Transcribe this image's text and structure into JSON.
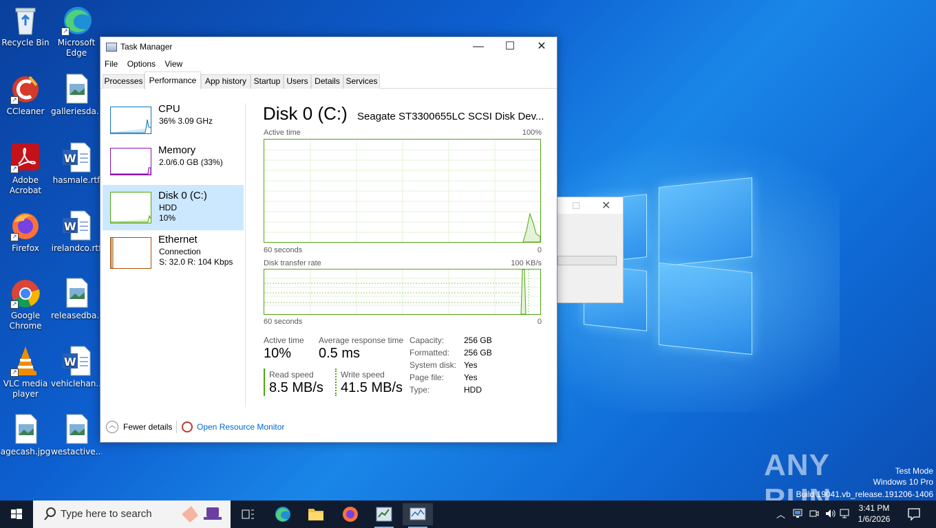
{
  "desktop": {
    "icons": [
      {
        "label": "Recycle Bin",
        "name": "recycle-bin"
      },
      {
        "label": "Microsoft\nEdge",
        "name": "microsoft-edge"
      },
      {
        "label": "CCleaner",
        "name": "ccleaner"
      },
      {
        "label": "galleriesda...",
        "name": "galleriesda"
      },
      {
        "label": "Adobe\nAcrobat",
        "name": "adobe-acrobat"
      },
      {
        "label": "hasmale.rtf",
        "name": "hasmale-rtf"
      },
      {
        "label": "Firefox",
        "name": "firefox"
      },
      {
        "label": "irelandco.rtf",
        "name": "irelandco-rtf"
      },
      {
        "label": "Google\nChrome",
        "name": "google-chrome"
      },
      {
        "label": "releasedba...",
        "name": "releasedba"
      },
      {
        "label": "VLC media\nplayer",
        "name": "vlc-media-player"
      },
      {
        "label": "vehiclehan...",
        "name": "vehiclehan"
      },
      {
        "label": "agecash.jpg",
        "name": "agecash-jpg"
      },
      {
        "label": "westactive...",
        "name": "westactive"
      }
    ]
  },
  "taskmanager": {
    "title": "Task Manager",
    "menu": [
      "File",
      "Options",
      "View"
    ],
    "tabs": [
      "Processes",
      "Performance",
      "App history",
      "Startup",
      "Users",
      "Details",
      "Services"
    ],
    "active_tab": "Performance",
    "sidebar": [
      {
        "name": "CPU",
        "sub1": "36%  3.09 GHz",
        "sub2": "",
        "color": "#1172b8"
      },
      {
        "name": "Memory",
        "sub1": "2.0/6.0 GB (33%)",
        "sub2": "",
        "color": "#8b12ae"
      },
      {
        "name": "Disk 0 (C:)",
        "sub1": "HDD",
        "sub2": "10%",
        "color": "#4da60c"
      },
      {
        "name": "Ethernet",
        "sub1": "Connection",
        "sub2": "S: 32.0  R: 104 Kbps",
        "color": "#a74f01"
      }
    ],
    "disk": {
      "title": "Disk 0 (C:)",
      "model": "Seagate ST3300655LC SCSI Disk Dev...",
      "active_time_label": "Active time",
      "active_time_max": "100%",
      "seconds_label": "60 seconds",
      "zero": "0",
      "transfer_label": "Disk transfer rate",
      "transfer_max": "100 KB/s",
      "stats": {
        "active_time_label": "Active time",
        "active_time": "10%",
        "avg_resp_label": "Average response time",
        "avg_resp": "0.5 ms",
        "read_label": "Read speed",
        "read": "8.5 MB/s",
        "write_label": "Write speed",
        "write": "41.5 MB/s"
      },
      "props": [
        {
          "k": "Capacity:",
          "v": "256 GB"
        },
        {
          "k": "Formatted:",
          "v": "256 GB"
        },
        {
          "k": "System disk:",
          "v": "Yes"
        },
        {
          "k": "Page file:",
          "v": "Yes"
        },
        {
          "k": "Type:",
          "v": "HDD"
        }
      ]
    },
    "footer": {
      "fewer": "Fewer details",
      "resmon": "Open Resource Monitor"
    }
  },
  "taskbar": {
    "search_placeholder": "Type here to search",
    "time": "3:41 PM",
    "date": "1/6/2026"
  },
  "watermark": {
    "brand": "ANY RUN",
    "line1": "Test Mode",
    "line2": "Windows 10 Pro",
    "line3": "Build 19041.vb_release.191206-1406"
  },
  "colors": {
    "disk_green": "#4da60c",
    "link_blue": "#0066cc",
    "selected": "#cce8ff"
  }
}
